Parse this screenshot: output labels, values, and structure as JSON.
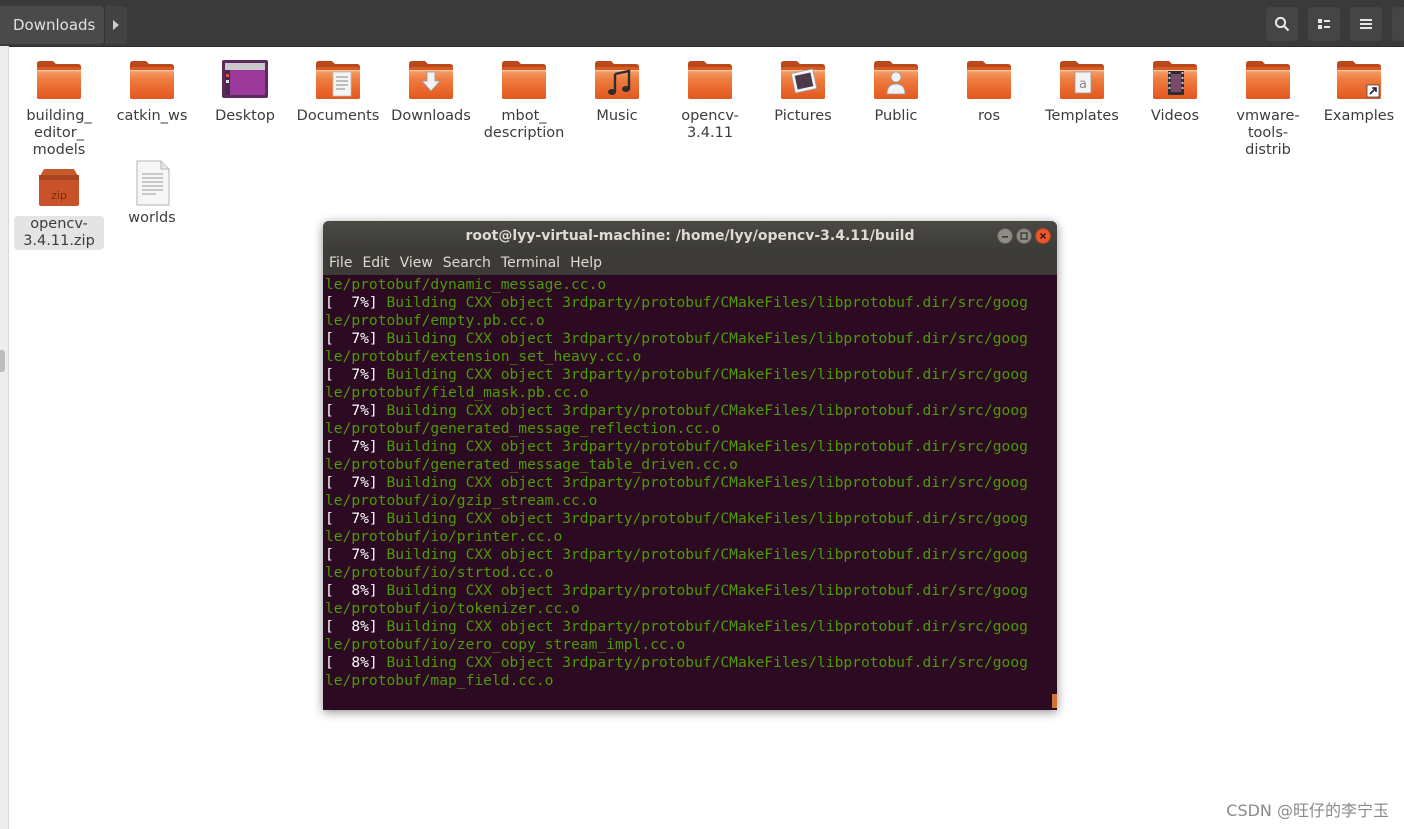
{
  "header": {
    "location": "Downloads",
    "search_icon": "search-icon",
    "view_icon": "list-view-icon",
    "menu_icon": "hamburger-menu-icon"
  },
  "files": [
    {
      "label": "building_ editor_ models",
      "icon": "folder-icon"
    },
    {
      "label": "catkin_ws",
      "icon": "folder-icon"
    },
    {
      "label": "Desktop",
      "icon": "desktop-folder-icon"
    },
    {
      "label": "Documents",
      "icon": "documents-folder-icon"
    },
    {
      "label": "Downloads",
      "icon": "downloads-folder-icon"
    },
    {
      "label": "mbot_ description",
      "icon": "folder-icon"
    },
    {
      "label": "Music",
      "icon": "music-folder-icon"
    },
    {
      "label": "opencv- 3.4.11",
      "icon": "folder-icon"
    },
    {
      "label": "Pictures",
      "icon": "pictures-folder-icon"
    },
    {
      "label": "Public",
      "icon": "public-folder-icon"
    },
    {
      "label": "ros",
      "icon": "folder-icon"
    },
    {
      "label": "Templates",
      "icon": "templates-folder-icon"
    },
    {
      "label": "Videos",
      "icon": "videos-folder-icon"
    },
    {
      "label": "vmware- tools- distrib",
      "icon": "folder-icon"
    },
    {
      "label": "Examples",
      "icon": "link-folder-icon"
    },
    {
      "label": "opencv- 3.4.11.zip",
      "icon": "zip-archive-icon"
    },
    {
      "label": "worlds",
      "icon": "text-file-icon"
    }
  ],
  "terminal": {
    "title": "root@lyy-virtual-machine: /home/lyy/opencv-3.4.11/build",
    "menu": [
      "File",
      "Edit",
      "View",
      "Search",
      "Terminal",
      "Help"
    ],
    "first_line": "le/protobuf/dynamic_message.cc.o",
    "lines": [
      {
        "pct": "[  7%]",
        "msg": " Building CXX object 3rdparty/protobuf/CMakeFiles/libprotobuf.dir/src/goog",
        "cont": "le/protobuf/empty.pb.cc.o"
      },
      {
        "pct": "[  7%]",
        "msg": " Building CXX object 3rdparty/protobuf/CMakeFiles/libprotobuf.dir/src/goog",
        "cont": "le/protobuf/extension_set_heavy.cc.o"
      },
      {
        "pct": "[  7%]",
        "msg": " Building CXX object 3rdparty/protobuf/CMakeFiles/libprotobuf.dir/src/goog",
        "cont": "le/protobuf/field_mask.pb.cc.o"
      },
      {
        "pct": "[  7%]",
        "msg": " Building CXX object 3rdparty/protobuf/CMakeFiles/libprotobuf.dir/src/goog",
        "cont": "le/protobuf/generated_message_reflection.cc.o"
      },
      {
        "pct": "[  7%]",
        "msg": " Building CXX object 3rdparty/protobuf/CMakeFiles/libprotobuf.dir/src/goog",
        "cont": "le/protobuf/generated_message_table_driven.cc.o"
      },
      {
        "pct": "[  7%]",
        "msg": " Building CXX object 3rdparty/protobuf/CMakeFiles/libprotobuf.dir/src/goog",
        "cont": "le/protobuf/io/gzip_stream.cc.o"
      },
      {
        "pct": "[  7%]",
        "msg": " Building CXX object 3rdparty/protobuf/CMakeFiles/libprotobuf.dir/src/goog",
        "cont": "le/protobuf/io/printer.cc.o"
      },
      {
        "pct": "[  7%]",
        "msg": " Building CXX object 3rdparty/protobuf/CMakeFiles/libprotobuf.dir/src/goog",
        "cont": "le/protobuf/io/strtod.cc.o"
      },
      {
        "pct": "[  8%]",
        "msg": " Building CXX object 3rdparty/protobuf/CMakeFiles/libprotobuf.dir/src/goog",
        "cont": "le/protobuf/io/tokenizer.cc.o"
      },
      {
        "pct": "[  8%]",
        "msg": " Building CXX object 3rdparty/protobuf/CMakeFiles/libprotobuf.dir/src/goog",
        "cont": "le/protobuf/io/zero_copy_stream_impl.cc.o"
      },
      {
        "pct": "[  8%]",
        "msg": " Building CXX object 3rdparty/protobuf/CMakeFiles/libprotobuf.dir/src/goog",
        "cont": "le/protobuf/map_field.cc.o"
      }
    ]
  },
  "watermark": "CSDN @旺仔的李宁玉",
  "colors": {
    "folder_orange": "#e95420",
    "terminal_bg": "#2c0a22",
    "terminal_green": "#4e9a06",
    "header_bg": "#3a3a3a"
  }
}
